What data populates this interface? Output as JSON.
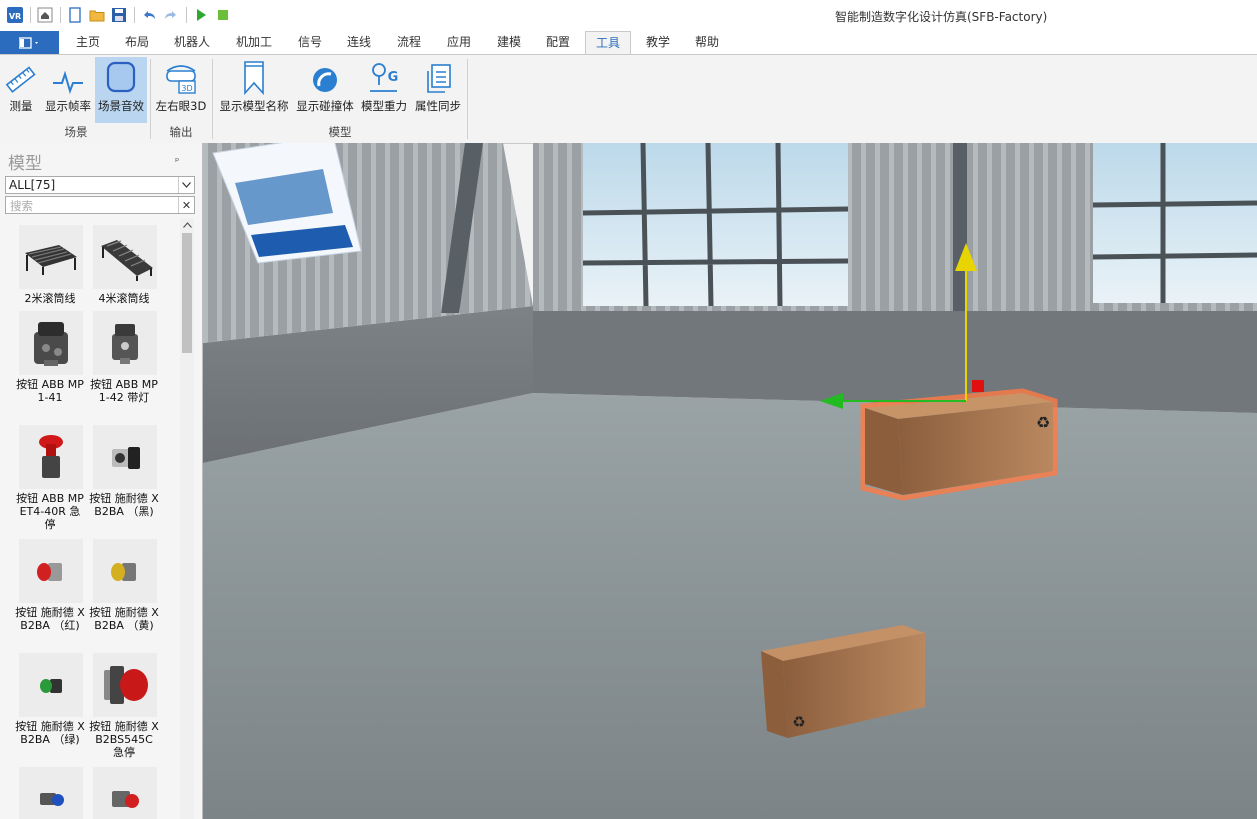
{
  "app": {
    "title": "智能制造数字化设计仿真(SFB-Factory)"
  },
  "quick_access": [
    "vr-logo-icon",
    "home-icon",
    "new-file-icon",
    "open-folder-icon",
    "save-icon",
    "undo-icon",
    "redo-icon",
    "play-icon",
    "stop-icon"
  ],
  "tabs": [
    {
      "label": "主页"
    },
    {
      "label": "布局"
    },
    {
      "label": "机器人"
    },
    {
      "label": "机加工"
    },
    {
      "label": "信号"
    },
    {
      "label": "连线"
    },
    {
      "label": "流程"
    },
    {
      "label": "应用"
    },
    {
      "label": "建模"
    },
    {
      "label": "配置"
    },
    {
      "label": "工具",
      "active": true
    },
    {
      "label": "教学"
    },
    {
      "label": "帮助"
    }
  ],
  "ribbon": {
    "buttons": [
      {
        "label": "测量",
        "icon": "ruler-icon"
      },
      {
        "label": "显示帧率",
        "icon": "pulse-icon"
      },
      {
        "label": "场景音效",
        "icon": "square-rounded-icon",
        "selected": true
      },
      {
        "label": "左右眼3D",
        "icon": "vr-glasses-icon"
      },
      {
        "label": "显示模型名称",
        "icon": "bookmark-icon"
      },
      {
        "label": "显示碰撞体",
        "icon": "collision-ball-icon"
      },
      {
        "label": "模型重力",
        "icon": "gravity-icon"
      },
      {
        "label": "属性同步",
        "icon": "sync-properties-icon"
      }
    ],
    "groups": [
      {
        "label": "场景"
      },
      {
        "label": "输出"
      },
      {
        "label": "模型"
      }
    ]
  },
  "panel": {
    "title": "模型",
    "pin": "ₚ",
    "filter_value": "ALL[75]",
    "search_placeholder": "搜索",
    "models": [
      {
        "label": "2米滚筒线"
      },
      {
        "label": "4米滚筒线"
      },
      {
        "label": "按钮 ABB MP1-41"
      },
      {
        "label": "按钮 ABB MP1-42 带灯"
      },
      {
        "label": "按钮 ABB MPET4-40R 急停"
      },
      {
        "label": "按钮 施耐德 XB2BA （黑)"
      },
      {
        "label": "按钮 施耐德 XB2BA （红)"
      },
      {
        "label": "按钮 施耐德 XB2BA （黄)"
      },
      {
        "label": "按钮 施耐德 XB2BA （绿)"
      },
      {
        "label": "按钮 施耐德 XB2BS545C 急停"
      },
      {
        "label": ""
      },
      {
        "label": ""
      }
    ]
  },
  "colors": {
    "accent": "#2b6cbf",
    "selected_bg": "#b9d5ef",
    "gizmo_y": "#e8d400",
    "gizmo_x": "#22bb22",
    "gizmo_z": "#e01010",
    "box": "#b07a4f",
    "highlight": "#ff7a45"
  }
}
